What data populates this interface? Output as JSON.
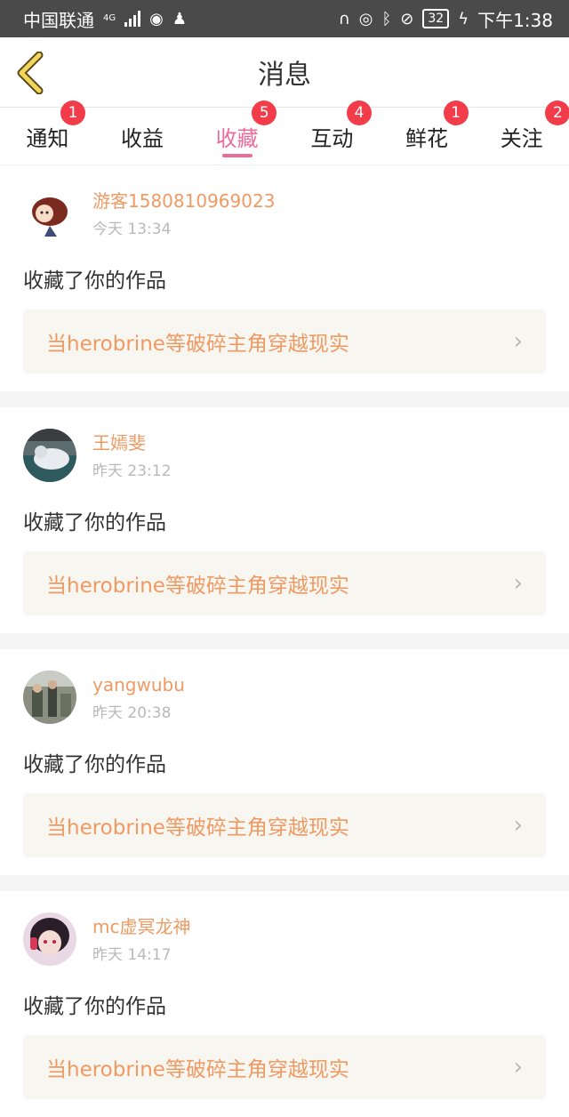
{
  "statusbar": {
    "carrier": "中国联通",
    "network": "4G",
    "battery": "32",
    "time": "下午1:38"
  },
  "header": {
    "title": "消息"
  },
  "tabs": [
    {
      "label": "通知",
      "badge": "1",
      "active": false
    },
    {
      "label": "收益",
      "badge": "",
      "active": false
    },
    {
      "label": "收藏",
      "badge": "5",
      "active": true
    },
    {
      "label": "互动",
      "badge": "4",
      "active": false
    },
    {
      "label": "鲜花",
      "badge": "1",
      "active": false
    },
    {
      "label": "关注",
      "badge": "2",
      "active": false
    }
  ],
  "items": [
    {
      "user": "游客1580810969023",
      "time": "今天 13:34",
      "action": "收藏了你的作品",
      "work": "当herobrine等破碎主角穿越现实"
    },
    {
      "user": "王嫣斐",
      "time": "昨天 23:12",
      "action": "收藏了你的作品",
      "work": "当herobrine等破碎主角穿越现实"
    },
    {
      "user": "yangwubu",
      "time": "昨天 20:38",
      "action": "收藏了你的作品",
      "work": "当herobrine等破碎主角穿越现实"
    },
    {
      "user": "mc虚冥龙神",
      "time": "昨天 14:17",
      "action": "收藏了你的作品",
      "work": "当herobrine等破碎主角穿越现实"
    }
  ],
  "colors": {
    "accent": "#ec6c99",
    "badge": "#f23c4a",
    "username": "#ef9a63"
  }
}
